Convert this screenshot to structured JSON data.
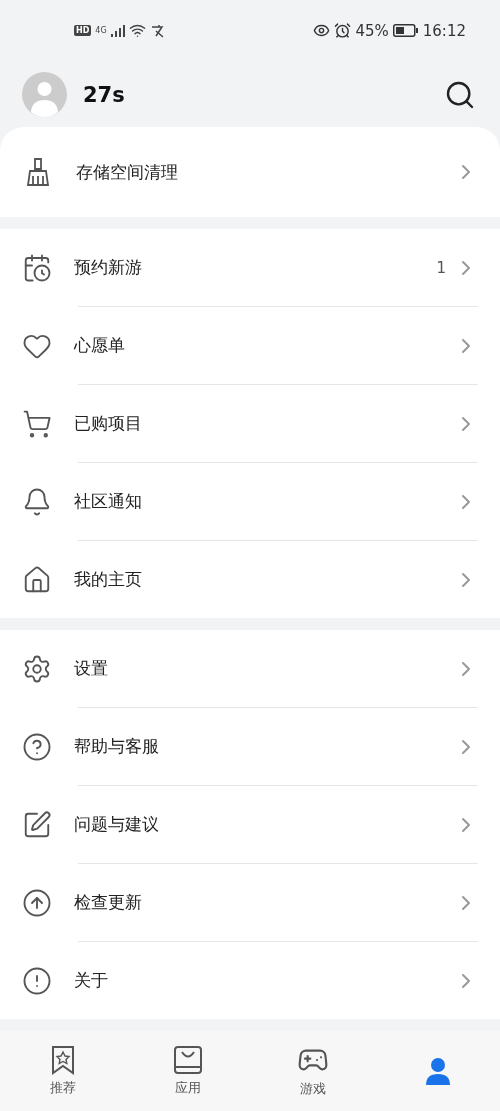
{
  "status_bar": {
    "hd": "HD",
    "network": "4G",
    "battery": "45%",
    "time": "16:12"
  },
  "profile": {
    "name": "27s"
  },
  "sections": [
    {
      "items": [
        {
          "kind": "broom",
          "label": "存储空间清理"
        }
      ]
    },
    {
      "items": [
        {
          "kind": "calendar",
          "label": "预约新游",
          "count": "1"
        },
        {
          "kind": "heart",
          "label": "心愿单"
        },
        {
          "kind": "cart",
          "label": "已购项目"
        },
        {
          "kind": "bell",
          "label": "社区通知"
        },
        {
          "kind": "home",
          "label": "我的主页"
        }
      ]
    },
    {
      "items": [
        {
          "kind": "gear",
          "label": "设置"
        },
        {
          "kind": "help",
          "label": "帮助与客服"
        },
        {
          "kind": "edit",
          "label": "问题与建议"
        },
        {
          "kind": "update",
          "label": "检查更新"
        },
        {
          "kind": "info",
          "label": "关于"
        }
      ]
    }
  ],
  "tabs": [
    {
      "kind": "star",
      "label": "推荐",
      "selected": false
    },
    {
      "kind": "bag",
      "label": "应用",
      "selected": false
    },
    {
      "kind": "gamepad",
      "label": "游戏",
      "selected": false
    },
    {
      "kind": "person",
      "selected": true
    }
  ]
}
